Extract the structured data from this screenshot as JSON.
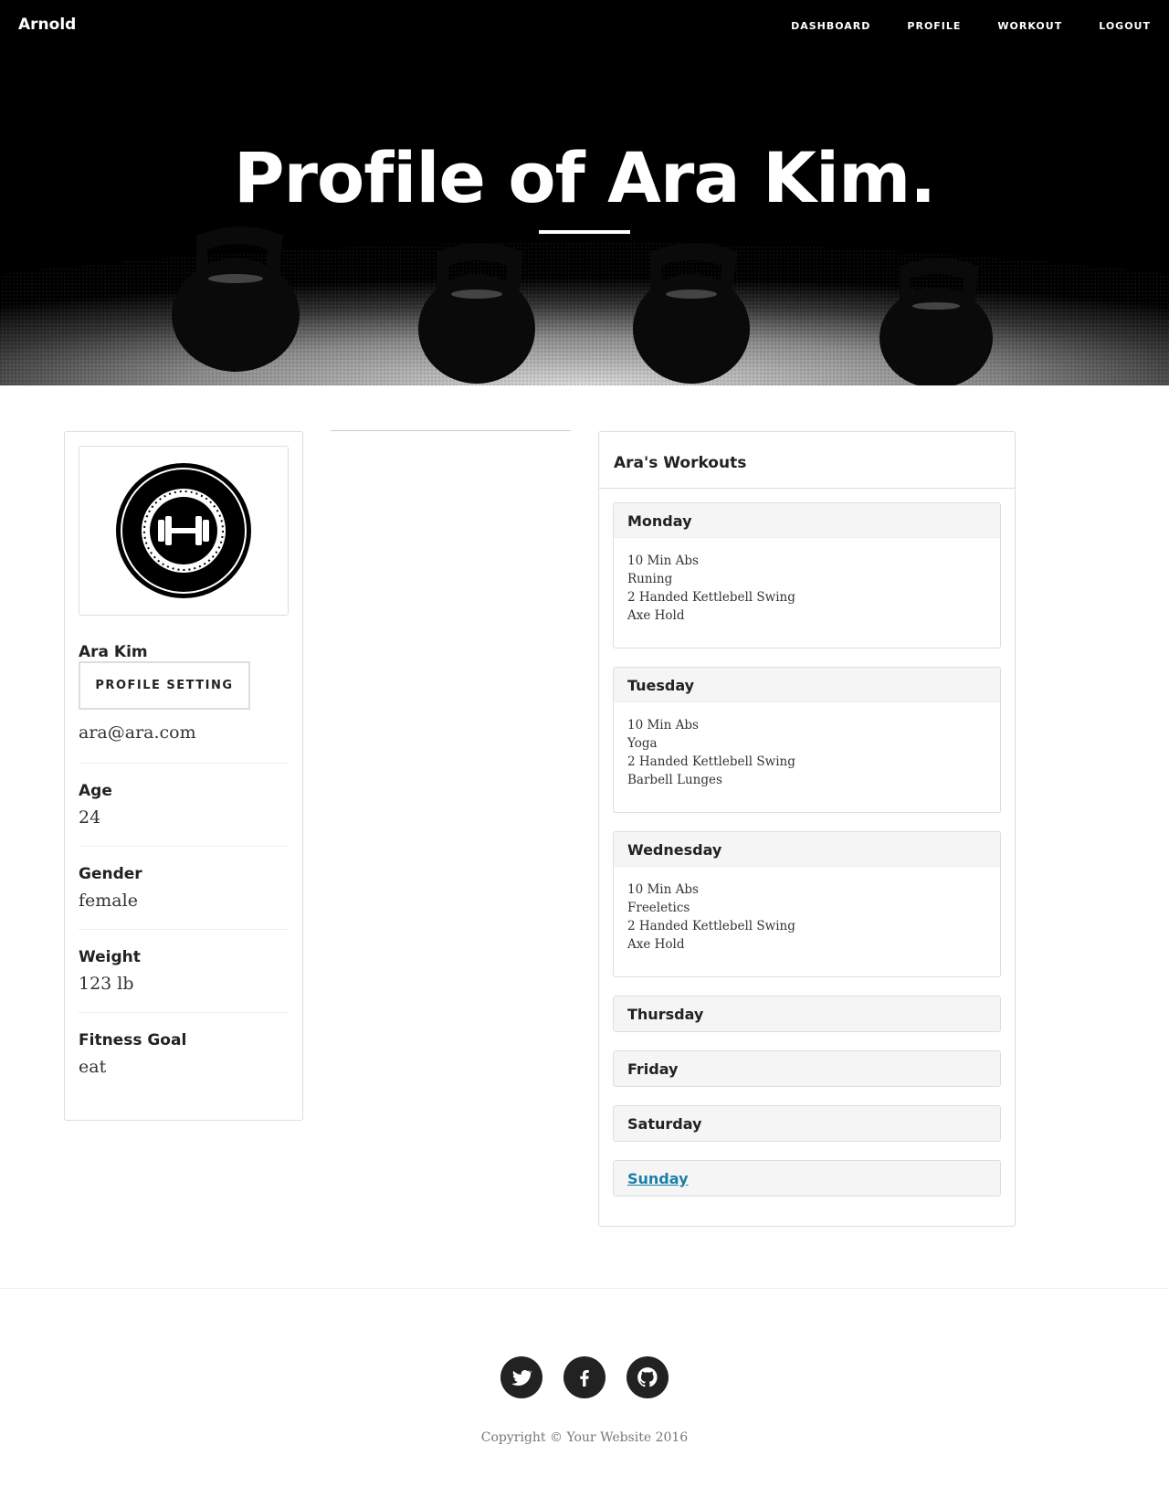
{
  "nav": {
    "brand": "Arnold",
    "links": [
      "DASHBOARD",
      "PROFILE",
      "WORKOUT",
      "LOGOUT"
    ]
  },
  "hero": {
    "title": "Profile of Ara Kim."
  },
  "profile": {
    "avatar_icon": "dumbbell-badge-icon",
    "name": "Ara Kim",
    "setting_label": "PROFILE SETTING",
    "email": "ara@ara.com",
    "fields": [
      {
        "label": "Age",
        "value": "24"
      },
      {
        "label": "Gender",
        "value": "female"
      },
      {
        "label": "Weight",
        "value": "123 lb"
      },
      {
        "label": "Fitness Goal",
        "value": "eat"
      }
    ]
  },
  "workouts": {
    "title": "Ara's Workouts",
    "days": [
      {
        "name": "Monday",
        "items": [
          "10 Min Abs",
          "Runing",
          "2 Handed Kettlebell Swing",
          "Axe Hold"
        ]
      },
      {
        "name": "Tuesday",
        "items": [
          "10 Min Abs",
          "Yoga",
          "2 Handed Kettlebell Swing",
          "Barbell Lunges"
        ]
      },
      {
        "name": "Wednesday",
        "items": [
          "10 Min Abs",
          "Freeletics",
          "2 Handed Kettlebell Swing",
          "Axe Hold"
        ]
      },
      {
        "name": "Thursday",
        "items": []
      },
      {
        "name": "Friday",
        "items": []
      },
      {
        "name": "Saturday",
        "items": []
      },
      {
        "name": "Sunday",
        "items": []
      }
    ],
    "link_color": "#1a7fa8"
  },
  "footer": {
    "socials": [
      "twitter-icon",
      "facebook-icon",
      "github-icon"
    ],
    "copyright": "Copyright © Your Website 2016"
  }
}
